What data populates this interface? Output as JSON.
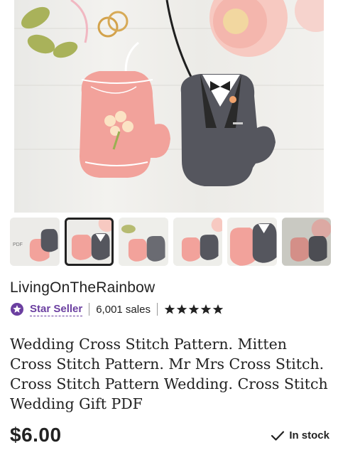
{
  "listing": {
    "shop_name": "LivingOnTheRainbow",
    "badge_label": "Star Seller",
    "sales": "6,001 sales",
    "rating_stars": 5,
    "title": "Wedding Cross Stitch Pattern. Mitten Cross Stitch Pattern. Mr Mrs Cross Stitch. Cross Stitch Pattern Wedding. Cross Stitch Wedding Gift PDF",
    "price": "$6.00",
    "stock_label": "In stock"
  },
  "gallery": {
    "thumbnail_count": 6,
    "selected_index": 1
  },
  "colors": {
    "star_seller_purple": "#6b3fa0",
    "text": "#222222",
    "mitten_pink": "#f2a29b",
    "mitten_gray": "#55565e"
  }
}
